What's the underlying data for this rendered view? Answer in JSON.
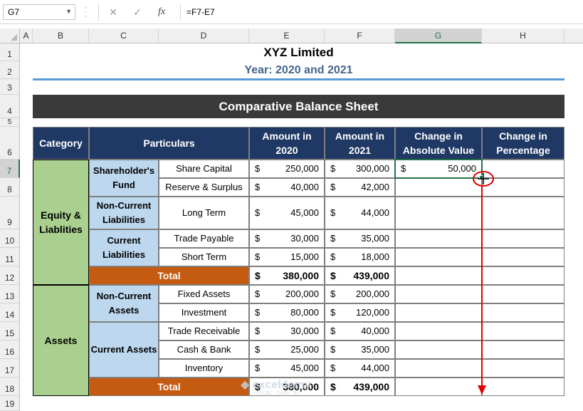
{
  "formula_bar": {
    "name_box": "G7",
    "cancel_icon": "✕",
    "enter_icon": "✓",
    "fx_label": "fx",
    "formula": "=F7-E7"
  },
  "columns": [
    "A",
    "B",
    "C",
    "D",
    "E",
    "F",
    "G",
    "H"
  ],
  "rows": [
    "1",
    "2",
    "3",
    "4",
    "5",
    "6",
    "7",
    "8",
    "9",
    "10",
    "11",
    "12",
    "13",
    "14",
    "15",
    "16",
    "17",
    "18",
    "19"
  ],
  "sheet": {
    "company": "XYZ Limited",
    "year": "Year: 2020 and 2021",
    "band_title": "Comparative Balance Sheet",
    "headers": {
      "category": "Category",
      "particulars": "Particulars",
      "amount2020_l1": "Amount in",
      "amount2020_l2": "2020",
      "amount2021_l1": "Amount in",
      "amount2021_l2": "2021",
      "change_abs_l1": "Change in",
      "change_abs_l2": "Absolute Value",
      "change_pct_l1": "Change in",
      "change_pct_l2": "Percentage"
    },
    "categories": {
      "equity_l1": "Equity &",
      "equity_l2": "Liablities",
      "assets": "Assets"
    },
    "groups": {
      "shareholders_l1": "Shareholder's",
      "shareholders_l2": "Fund",
      "ncl_l1": "Non-Current",
      "ncl_l2": "Liabilities",
      "cl_l1": "Current",
      "cl_l2": "Liabilities",
      "nca_l1": "Non-Current",
      "nca_l2": "Assets",
      "ca": "Current Assets"
    },
    "currency": "$",
    "items": [
      {
        "name": "Share Capital",
        "y2020": "250,000",
        "y2021": "300,000"
      },
      {
        "name": "Reserve & Surplus",
        "y2020": "40,000",
        "y2021": "42,000"
      },
      {
        "name": "Long Term",
        "y2020": "45,000",
        "y2021": "44,000"
      },
      {
        "name": "Trade Payable",
        "y2020": "30,000",
        "y2021": "35,000"
      },
      {
        "name": "Short Term",
        "y2020": "15,000",
        "y2021": "18,000"
      },
      {
        "name": "Fixed Assets",
        "y2020": "200,000",
        "y2021": "200,000"
      },
      {
        "name": "Investment",
        "y2020": "80,000",
        "y2021": "120,000"
      },
      {
        "name": "Trade Receivable",
        "y2020": "30,000",
        "y2021": "40,000"
      },
      {
        "name": "Cash & Bank",
        "y2020": "25,000",
        "y2021": "35,000"
      },
      {
        "name": "Inventory",
        "y2020": "45,000",
        "y2021": "44,000"
      }
    ],
    "total_label": "Total",
    "total1": {
      "y2020": "380,000",
      "y2021": "439,000"
    },
    "total2": {
      "y2020": "380,000",
      "y2021": "439,000"
    },
    "g7_value": "50,000"
  },
  "watermark": {
    "brand": "exceldemy",
    "tagline": "EXCEL · DATA · BI"
  },
  "colors": {
    "header_navy": "#1f3864",
    "category_green": "#a9d08e",
    "group_blue": "#bdd7ee",
    "total_orange": "#c55a11",
    "band_dark": "#3a3a3a",
    "annotation_red": "#e00000",
    "selection_green": "#217346"
  }
}
